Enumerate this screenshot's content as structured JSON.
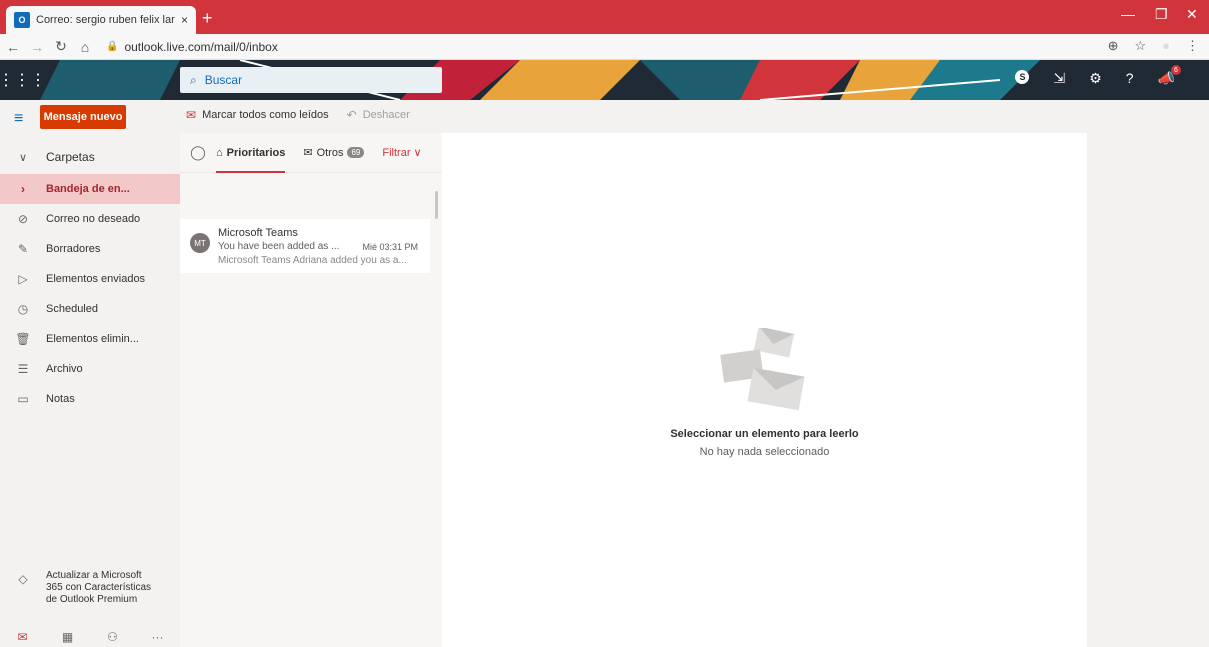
{
  "browser": {
    "tab_title": "Correo: sergio ruben felix lara - C",
    "favicon": "O",
    "tab_close": "×",
    "new_tab": "+",
    "url": "outlook.live.com/mail/0/inbox",
    "min": "—",
    "restore": "❐",
    "close": "✕"
  },
  "header": {
    "waffle": "⋮⋮⋮",
    "search_placeholder": "Buscar",
    "skype": "S",
    "notif_count": "6",
    "help": "?"
  },
  "nav": {
    "new_message": "Mensaje nuevo",
    "folders_header": "Carpetas",
    "folders": [
      {
        "label": "Bandeja de en...",
        "icon": "chevron-right-icon"
      },
      {
        "label": "Correo no deseado",
        "icon": "blocked-icon"
      },
      {
        "label": "Borradores",
        "icon": "pencil-icon"
      },
      {
        "label": "Elementos enviados",
        "icon": "send-icon"
      },
      {
        "label": "Scheduled",
        "icon": "clock-icon"
      },
      {
        "label": "Elementos elimin...",
        "icon": "trash-icon"
      },
      {
        "label": "Archivo",
        "icon": "archive-icon"
      },
      {
        "label": "Notas",
        "icon": "note-icon"
      }
    ],
    "upgrade": "Actualizar a Microsoft 365 con Características de Outlook Premium"
  },
  "commands": {
    "mark_all_read": "Marcar todos como leídos",
    "undo": "Deshacer"
  },
  "list": {
    "focused": "Prioritarios",
    "other": "Otros",
    "other_count": "69",
    "filter": "Filtrar",
    "items": [
      {
        "initials": "MT",
        "sender": "Microsoft Teams",
        "subject": "You have been added as ...",
        "time": "Mié 03:31 PM",
        "preview": "Microsoft Teams Adriana added you as a..."
      }
    ]
  },
  "reading": {
    "title": "Seleccionar un elemento para leerlo",
    "subtitle": "No hay nada seleccionado"
  },
  "colors": {
    "brand": "#0f6cbd",
    "accent": "#d13438",
    "tabbar": "#d1343a",
    "new_message_bg": "#d83b01",
    "selected_folder_bg": "#f2c8c9"
  }
}
